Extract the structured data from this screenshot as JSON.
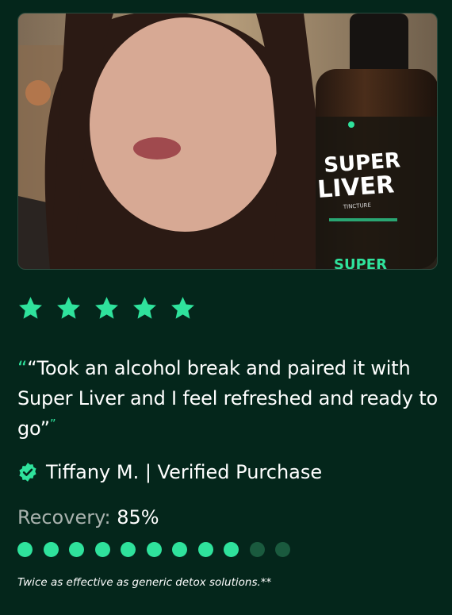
{
  "photo": {
    "bottle_brand": "SUPER",
    "bottle_product": "LIVER",
    "bottle_sub": "TINCTURE",
    "bottle_bottom": "SUPER"
  },
  "rating": {
    "stars": 5,
    "max": 5,
    "color": "#2fe29c"
  },
  "review": {
    "open_quote": "“",
    "text": "“Took an alcohol break and paired it with Super Liver and I feel refreshed and ready to go”",
    "close_quote": "”"
  },
  "author": {
    "name": "Tiffany M. | Verified Purchase",
    "badge_icon": "verified-badge-icon"
  },
  "recovery": {
    "label": "Recovery:",
    "value": "85%",
    "filled": 9,
    "total": 11
  },
  "footnote": "Twice as effective as generic detox solutions.**",
  "colors": {
    "background": "#04261b",
    "accent": "#2fe29c",
    "dot_off": "#1a5a3e"
  }
}
